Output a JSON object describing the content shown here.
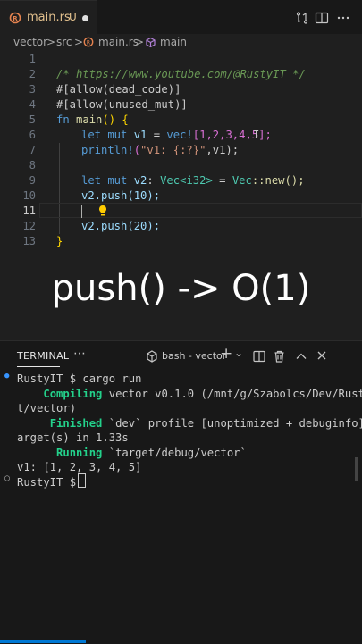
{
  "tab": {
    "filename": "main.rs",
    "status": "U"
  },
  "breadcrumb": {
    "folder1": "vector",
    "sep1": ">",
    "folder2": "src",
    "sep2": ">",
    "file": "main.rs",
    "sep3": ">",
    "symbol": "main"
  },
  "code_lines": [
    {
      "n": "1"
    },
    {
      "n": "2"
    },
    {
      "n": "3"
    },
    {
      "n": "4"
    },
    {
      "n": "5"
    },
    {
      "n": "6"
    },
    {
      "n": "7"
    },
    {
      "n": "8"
    },
    {
      "n": "9"
    },
    {
      "n": "10"
    },
    {
      "n": "11"
    },
    {
      "n": "12"
    },
    {
      "n": "13"
    }
  ],
  "code": {
    "l1": "/* https://www.youtube.com/@RustyIT */",
    "l2": "#[allow(dead_code)]",
    "l3": "#[allow(unused_mut)]",
    "l4_kw": "fn",
    "l4_name": "main",
    "l4_rest": "() {",
    "l5_kw": "let mut",
    "l5_var": "v1",
    "l5_eq": " = ",
    "l5_mac": "vec!",
    "l5_rest": "[1,2,3,4,5];",
    "l6_mac": "println!",
    "l6_open": "(",
    "l6_str": "\"v1: {:?}\"",
    "l6_rest": ",v1);",
    "l8_kw": "let mut",
    "l8_var": "v2",
    "l8_colon": ": ",
    "l8_type": "Vec<i32>",
    "l8_eq": " = ",
    "l8_type2": "Vec",
    "l8_rest": "::new();",
    "l9": "v2.push(10);",
    "l10": "v2.push(20);",
    "l12": "}"
  },
  "caption": "push() ->  O(1)",
  "panel": {
    "tab": "TERMINAL",
    "more": "⋯",
    "shell": "bash - vector",
    "add": "+",
    "chevron": "⌄"
  },
  "terminal": [
    "RustyIT $ cargo run",
    "    Compiling vector v0.1.0 (/mnt/g/Szabolcs/Dev/RustyI",
    "t/vector)",
    "     Finished `dev` profile [unoptimized + debuginfo] t",
    "arget(s) in 1.33s",
    "      Running `target/debug/vector`",
    "v1: [1, 2, 3, 4, 5]",
    "RustyIT $ "
  ],
  "term_green": {
    "compiling": "Compiling",
    "finished": "Finished",
    "running": "Running"
  },
  "term_rest": {
    "compiling": " vector v0.1.0 (/mnt/g/Szabolcs/Dev/RustyI",
    "finished": " `dev` profile [unoptimized + debuginfo] t",
    "running": " `target/debug/vector`"
  },
  "colors": {
    "accent": "#0078d4",
    "rust": "#e4824f",
    "modified": "#e2c08d",
    "green": "#23d18b"
  }
}
